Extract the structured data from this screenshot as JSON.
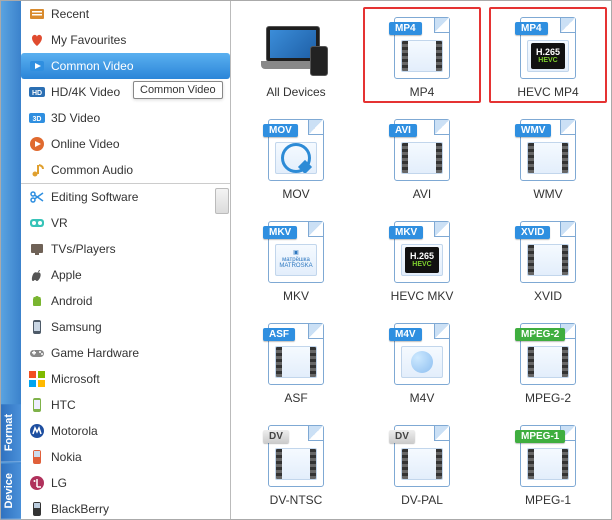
{
  "sidebar": {
    "tabs": {
      "format": "Format",
      "device": "Device"
    },
    "format_items": [
      {
        "label": "Recent",
        "icon": "recent-icon",
        "color": "#d98b2e"
      },
      {
        "label": "My Favourites",
        "icon": "heart-icon",
        "color": "#e04b2f"
      },
      {
        "label": "Common Video",
        "icon": "video-icon",
        "color": "#2f8fe0",
        "selected": true
      },
      {
        "label": "HD/4K Video",
        "icon": "hd-icon",
        "color": "#2b6fb3",
        "tooltip": "Common Video"
      },
      {
        "label": "3D Video",
        "icon": "3d-icon",
        "color": "#2f8fe0"
      },
      {
        "label": "Online Video",
        "icon": "online-icon",
        "color": "#e06a2f"
      },
      {
        "label": "Common Audio",
        "icon": "audio-icon",
        "color": "#e0a02f"
      }
    ],
    "device_items": [
      {
        "label": "Editing Software",
        "icon": "scissors-icon",
        "color": "#2f8fe0"
      },
      {
        "label": "VR",
        "icon": "vr-icon",
        "color": "#37c3b8"
      },
      {
        "label": "TVs/Players",
        "icon": "tv-icon",
        "color": "#6f6257"
      },
      {
        "label": "Apple",
        "icon": "apple-icon",
        "color": "#555"
      },
      {
        "label": "Android",
        "icon": "android-icon",
        "color": "#79b530"
      },
      {
        "label": "Samsung",
        "icon": "samsung-icon",
        "color": "#4d5a68"
      },
      {
        "label": "Game Hardware",
        "icon": "game-icon",
        "color": "#888"
      },
      {
        "label": "Microsoft",
        "icon": "microsoft-icon",
        "color": "#multi"
      },
      {
        "label": "HTC",
        "icon": "htc-icon",
        "color": "#7fb24a"
      },
      {
        "label": "Motorola",
        "icon": "motorola-icon",
        "color": "#1e4fa0"
      },
      {
        "label": "Nokia",
        "icon": "nokia-icon",
        "color": "#e0603a"
      },
      {
        "label": "LG",
        "icon": "lg-icon",
        "color": "#b0315c"
      },
      {
        "label": "BlackBerry",
        "icon": "blackberry-icon",
        "color": "#333"
      }
    ]
  },
  "grid": {
    "items": [
      {
        "label": "All Devices",
        "badge": "",
        "art": "devices",
        "highlight": false
      },
      {
        "label": "MP4",
        "badge": "MP4",
        "art": "film",
        "highlight": true
      },
      {
        "label": "HEVC MP4",
        "badge": "MP4",
        "art": "h265",
        "highlight": true
      },
      {
        "label": "MOV",
        "badge": "MOV",
        "art": "q",
        "highlight": false
      },
      {
        "label": "AVI",
        "badge": "AVI",
        "art": "film",
        "highlight": false
      },
      {
        "label": "WMV",
        "badge": "WMV",
        "art": "film",
        "highlight": false
      },
      {
        "label": "MKV",
        "badge": "MKV",
        "art": "matroska",
        "highlight": false
      },
      {
        "label": "HEVC MKV",
        "badge": "MKV",
        "art": "h265",
        "highlight": false
      },
      {
        "label": "XVID",
        "badge": "XVID",
        "art": "film",
        "highlight": false
      },
      {
        "label": "ASF",
        "badge": "ASF",
        "art": "film",
        "highlight": false
      },
      {
        "label": "M4V",
        "badge": "M4V",
        "art": "note",
        "highlight": false
      },
      {
        "label": "MPEG-2",
        "badge": "MPEG-2",
        "art": "film",
        "highlight": false,
        "badgeClass": "mpeg-badge"
      },
      {
        "label": "DV-NTSC",
        "badge": "DV",
        "art": "film",
        "highlight": false,
        "badgeClass": "silver"
      },
      {
        "label": "DV-PAL",
        "badge": "DV",
        "art": "film",
        "highlight": false,
        "badgeClass": "silver"
      },
      {
        "label": "MPEG-1",
        "badge": "MPEG-1",
        "art": "film",
        "highlight": false,
        "badgeClass": "mpeg-badge"
      }
    ]
  }
}
